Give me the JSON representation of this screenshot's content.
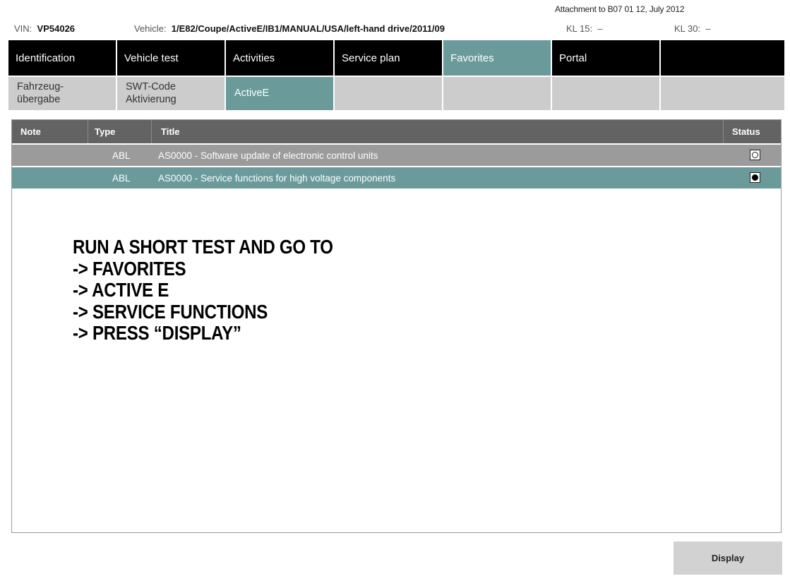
{
  "attachment_note": "Attachment to B07 01 12, July 2012",
  "vehicle_info": {
    "vin_label": "VIN:",
    "vin_value": "VP54026",
    "vehicle_label": "Vehicle:",
    "vehicle_value": "1/E82/Coupe/ActiveE/IB1/MANUAL/USA/left-hand drive/2011/09",
    "kl15_label": "KL 15:",
    "kl15_value": "–",
    "kl30_label": "KL 30:",
    "kl30_value": "–"
  },
  "main_tabs": [
    {
      "label": "Identification"
    },
    {
      "label": "Vehicle test"
    },
    {
      "label": "Activities"
    },
    {
      "label": "Service plan"
    },
    {
      "label": "Favorites",
      "active": true
    },
    {
      "label": "Portal"
    }
  ],
  "sub_tabs": [
    {
      "line1": "Fahrzeug-",
      "line2": "übergabe"
    },
    {
      "line1": "SWT-Code",
      "line2": "Aktivierung"
    },
    {
      "label": "ActiveE",
      "active": true
    }
  ],
  "table": {
    "headers": {
      "note": "Note",
      "type": "Type",
      "title": "Title",
      "status": "Status"
    },
    "rows": [
      {
        "note": "",
        "type": "ABL",
        "title": "AS0000 - Software update of electronic control units",
        "selected": false
      },
      {
        "note": "",
        "type": "ABL",
        "title": "AS0000 - Service functions for high voltage components",
        "selected": true
      }
    ]
  },
  "instructions": [
    "RUN A SHORT TEST AND GO TO",
    "-> FAVORITES",
    "-> ACTIVE E",
    "-> SERVICE FUNCTIONS",
    "-> PRESS “DISPLAY”"
  ],
  "display_button": "Display",
  "colors": {
    "accent": "#6a9a9a",
    "header_bar": "#000000",
    "table_header": "#636363",
    "row_unselected": "#9b9b9b",
    "subtab_bg": "#cccccc",
    "button_bg": "#d2d2d2"
  }
}
